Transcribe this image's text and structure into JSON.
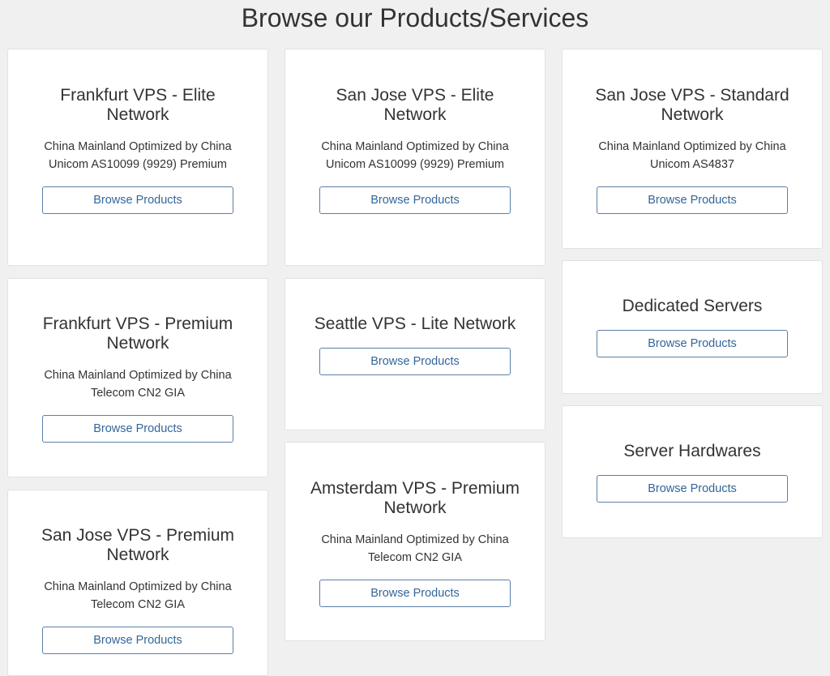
{
  "page": {
    "title": "Browse our Products/Services"
  },
  "cards": [
    {
      "title": "Frankfurt VPS - Elite Network",
      "description": "China Mainland Optimized by China Unicom AS10099 (9929) Premium",
      "button_label": "Browse Products"
    },
    {
      "title": "Frankfurt VPS - Premium Network",
      "description": "China Mainland Optimized by China Telecom CN2 GIA",
      "button_label": "Browse Products"
    },
    {
      "title": "San Jose VPS - Premium Network",
      "description": "China Mainland Optimized by China Telecom CN2 GIA",
      "button_label": "Browse Products"
    },
    {
      "title": "San Jose VPS - Elite Network",
      "description": "China Mainland Optimized by China Unicom AS10099 (9929) Premium",
      "button_label": "Browse Products"
    },
    {
      "title": "Seattle VPS - Lite Network",
      "description": "",
      "button_label": "Browse Products"
    },
    {
      "title": "Amsterdam VPS - Premium Network",
      "description": "China Mainland Optimized by China Telecom CN2 GIA",
      "button_label": "Browse Products"
    },
    {
      "title": "San Jose VPS - Standard Network",
      "description": "China Mainland Optimized by China Unicom AS4837",
      "button_label": "Browse Products"
    },
    {
      "title": "Dedicated Servers",
      "description": "",
      "button_label": "Browse Products"
    },
    {
      "title": "Server Hardwares",
      "description": "",
      "button_label": "Browse Products"
    }
  ],
  "colors": {
    "background": "#f0f0f0",
    "card_background": "#ffffff",
    "button_border": "#5b7fa6",
    "button_text": "#336699",
    "text": "#333333"
  }
}
